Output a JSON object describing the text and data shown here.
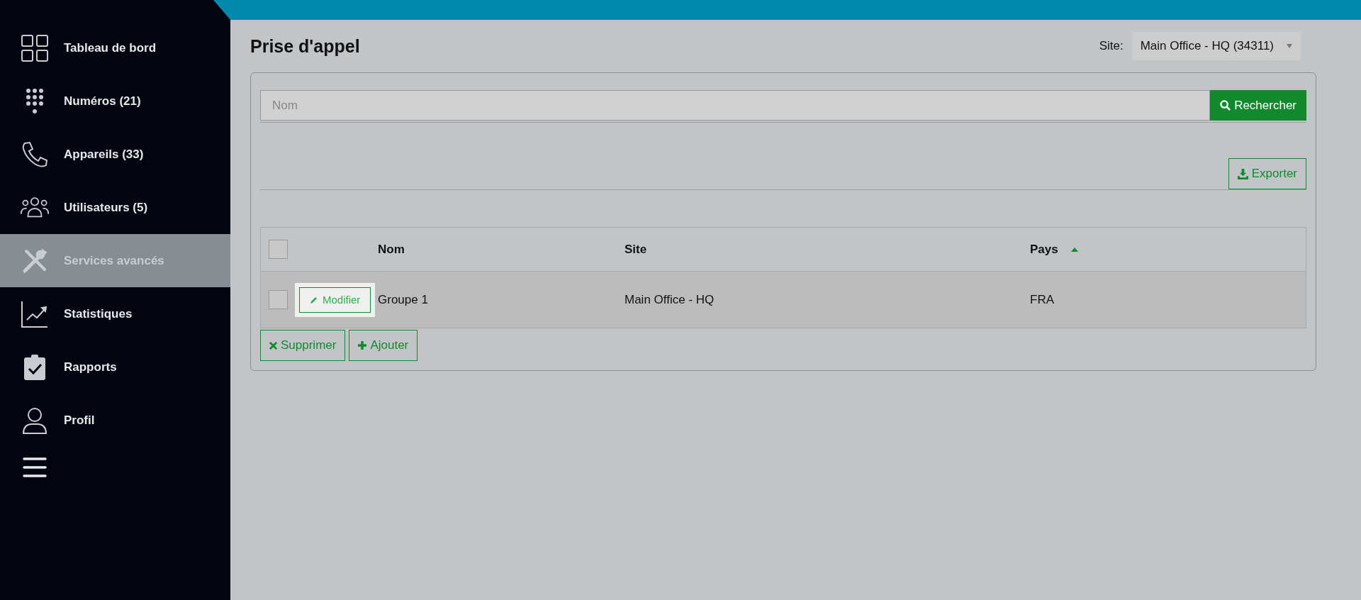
{
  "sidebar": {
    "items": [
      {
        "label": "Tableau de bord",
        "kind": "grid",
        "selected": false
      },
      {
        "label": "Numéros (21)",
        "kind": "keypad",
        "selected": false
      },
      {
        "label": "Appareils (33)",
        "kind": "phone",
        "selected": false
      },
      {
        "label": "Utilisateurs (5)",
        "kind": "users",
        "selected": false
      },
      {
        "label": "Services avancés",
        "kind": "tools",
        "selected": true
      },
      {
        "label": "Statistiques",
        "kind": "chart",
        "selected": false
      },
      {
        "label": "Rapports",
        "kind": "clipboard",
        "selected": false
      },
      {
        "label": "Profil",
        "kind": "person",
        "selected": false
      }
    ]
  },
  "page": {
    "title": "Prise d'appel",
    "site_label": "Site:",
    "site_value": "Main Office - HQ (34311)"
  },
  "search": {
    "placeholder": "Nom",
    "button": "Rechercher"
  },
  "export_button": "Exporter",
  "table": {
    "select_all_checked": false,
    "columns": [
      {
        "label": "Nom",
        "sorted": false
      },
      {
        "label": "Site",
        "sorted": false
      },
      {
        "label": "Pays",
        "sorted": true
      }
    ],
    "rows": [
      {
        "checked": false,
        "edit_button": "Modifier",
        "cells": [
          "Groupe 1",
          "Main Office - HQ",
          "FRA"
        ]
      }
    ]
  },
  "actions": [
    {
      "kind": "delete",
      "label": "Supprimer"
    },
    {
      "kind": "add",
      "label": "Ajouter"
    }
  ]
}
